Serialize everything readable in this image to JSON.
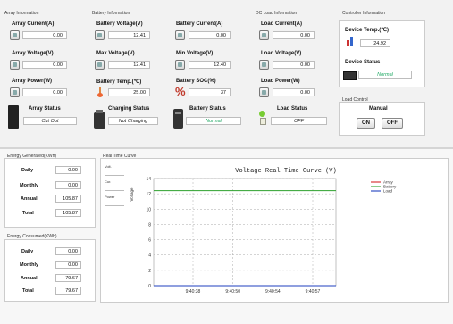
{
  "array": {
    "title": "Array Information",
    "current_label": "Array Current(A)",
    "current": "0.00",
    "voltage_label": "Array Voltage(V)",
    "voltage": "0.00",
    "power_label": "Array Power(W)",
    "power": "0.00",
    "status_label": "Array Status",
    "status": "Cut Out"
  },
  "battery": {
    "title": "Battery Information",
    "voltage_label": "Battery Voltage(V)",
    "voltage": "12.41",
    "current_label": "Battery Current(A)",
    "current": "0.00",
    "max_v_label": "Max Voltage(V)",
    "max_v": "12.41",
    "min_v_label": "Min Voltage(V)",
    "min_v": "12.40",
    "temp_label": "Battery Temp.(℃)",
    "temp": "25.00",
    "soc_label": "Battery SOC(%)",
    "soc": "37",
    "charging_label": "Charging Status",
    "charging": "Not Charging",
    "status_label": "Battery Status",
    "status": "Normal"
  },
  "load": {
    "title": "DC Load Information",
    "current_label": "Load Current(A)",
    "current": "0.00",
    "voltage_label": "Load Voltage(V)",
    "voltage": "0.00",
    "power_label": "Load Power(W)",
    "power": "0.00",
    "status_label": "Load Status",
    "status": "OFF"
  },
  "controller": {
    "title": "Controller Information",
    "temp_label": "Device Temp.(℃)",
    "temp": "24.92",
    "status_label": "Device Status",
    "status": "Normal"
  },
  "load_control": {
    "title": "Load Control",
    "mode": "Manual",
    "on_label": "ON",
    "off_label": "OFF"
  },
  "energy_generated": {
    "title": "Energy Generated(KWh)",
    "rows": [
      {
        "label": "Daily",
        "value": "0.00"
      },
      {
        "label": "Monthly",
        "value": "0.00"
      },
      {
        "label": "Annual",
        "value": "105.87"
      },
      {
        "label": "Total",
        "value": "105.87"
      }
    ]
  },
  "energy_consumed": {
    "title": "Energy Consumed(KWh)",
    "rows": [
      {
        "label": "Daily",
        "value": "0.00"
      },
      {
        "label": "Monthly",
        "value": "0.00"
      },
      {
        "label": "Annual",
        "value": "79.67"
      },
      {
        "label": "Total",
        "value": "79.67"
      }
    ]
  },
  "curve": {
    "panel_title": "Real Time Curve",
    "buttons": [
      "Volt.",
      "Cur.",
      "Power"
    ]
  },
  "colors": {
    "array": "#d62728",
    "battery": "#2ca02c",
    "load": "#1f3fbf"
  },
  "chart_data": {
    "type": "line",
    "title": "Voltage Real Time Curve (V)",
    "ylabel": "Voltage",
    "xlabel": "",
    "x": [
      "9:40:38",
      "9:40:50",
      "9:40:54",
      "9:40:57"
    ],
    "ylim": [
      0,
      14
    ],
    "yticks": [
      0,
      2,
      4,
      6,
      8,
      10,
      12,
      14
    ],
    "grid": true,
    "legend_position": "top-right",
    "series": [
      {
        "name": "Array",
        "values": [
          0,
          0,
          0,
          0
        ]
      },
      {
        "name": "Battery",
        "values": [
          12.41,
          12.41,
          12.41,
          12.41
        ]
      },
      {
        "name": "Load",
        "values": [
          0,
          0,
          0,
          0
        ]
      }
    ]
  }
}
